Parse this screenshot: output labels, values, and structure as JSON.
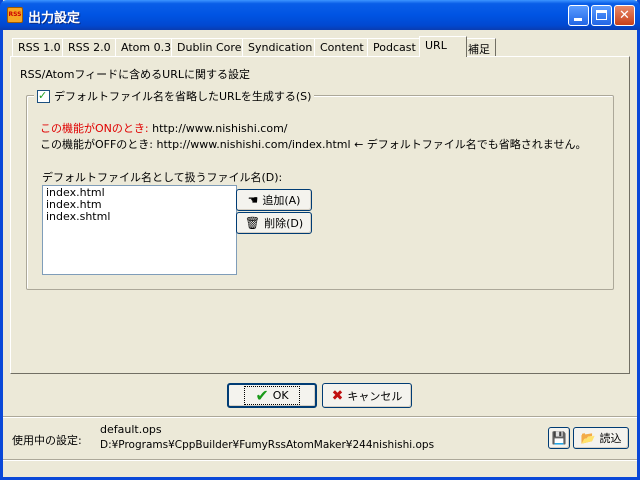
{
  "window": {
    "title": "出力設定",
    "app_icon_text": "RSS"
  },
  "tabs": [
    {
      "label": "RSS 1.0"
    },
    {
      "label": "RSS 2.0"
    },
    {
      "label": "Atom 0.3"
    },
    {
      "label": "Dublin Core"
    },
    {
      "label": "Syndication"
    },
    {
      "label": "Content"
    },
    {
      "label": "Podcast"
    },
    {
      "label": "URL"
    },
    {
      "label": "補足"
    }
  ],
  "active_tab": "URL",
  "url_panel": {
    "description": "RSS/Atomフィードに含めるURLに関する設定",
    "checkbox_label": "デフォルトファイル名を省略したURLを生成する(S)",
    "checkbox_checked": true,
    "on_label": "この機能がONのとき:",
    "on_value": "http://www.nishishi.com/",
    "off_line": "この機能がOFFのとき: http://www.nishishi.com/index.html ← デフォルトファイル名でも省略されません。",
    "list_label": "デフォルトファイル名として扱うファイル名(D):",
    "list_items": [
      "index.html",
      "index.htm",
      "index.shtml"
    ],
    "add_button": "追加(A)",
    "delete_button": "削除(D)"
  },
  "dialog_buttons": {
    "ok": "OK",
    "cancel": "キャンセル"
  },
  "footer": {
    "setting_label": "使用中の設定:",
    "setting_name": "default.ops",
    "setting_path": "D:¥Programs¥CppBuilder¥FumyRssAtomMaker¥244nishishi.ops",
    "load_button": "読込"
  },
  "colors": {
    "titlebar": "#0054e3",
    "on_label": "#e00000",
    "window_bg": "#ece9d8"
  }
}
